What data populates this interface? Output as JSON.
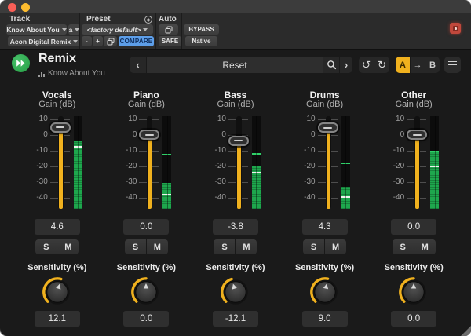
{
  "window": {
    "traffic_lights": [
      {
        "name": "close",
        "color": "#f95f57"
      },
      {
        "name": "minimize",
        "color": "#fdbc2f"
      }
    ]
  },
  "toolbar": {
    "track_label": "Track",
    "track_name": "Know About You",
    "automation_mode": "a",
    "plugin_name": "Acon Digital Remix",
    "preset_label": "Preset",
    "preset_value": "<factory default>",
    "minus_label": "-",
    "plus_label": "+",
    "compare_label": "COMPARE",
    "auto_label": "Auto",
    "safe_label": "SAFE",
    "bypass_label": "BYPASS",
    "native_label": "Native"
  },
  "header": {
    "title": "Remix",
    "subtitle": "Know About You",
    "prev_label": "‹",
    "nav_value": "Reset",
    "next_label": "›",
    "undo_label": "↺",
    "redo_label": "↻",
    "ab": {
      "a": "A",
      "arrow": "→",
      "b": "B",
      "active": "A"
    }
  },
  "strip_labels": {
    "gain": "Gain (dB)",
    "sensitivity": "Sensitivity (%)",
    "solo": "S",
    "mute": "M"
  },
  "gain_scale_ticks": [
    10,
    0,
    -10,
    -20,
    -30,
    -40
  ],
  "strips": [
    {
      "name": "Vocals",
      "gain_db": 4.6,
      "gain_display": "4.6",
      "sensitivity_pct": 12.1,
      "sensitivity_display": "12.1",
      "meter": {
        "level_db": -3.5,
        "peak_db": -7,
        "hold_db": null
      }
    },
    {
      "name": "Piano",
      "gain_db": 0.0,
      "gain_display": "0.0",
      "sensitivity_pct": 0.0,
      "sensitivity_display": "0.0",
      "meter": {
        "level_db": -30.5,
        "peak_db": -37.5,
        "hold_db": -12
      }
    },
    {
      "name": "Bass",
      "gain_db": -3.8,
      "gain_display": "-3.8",
      "sensitivity_pct": -12.1,
      "sensitivity_display": "-12.1",
      "meter": {
        "level_db": -19.5,
        "peak_db": -23.5,
        "hold_db": -11.5
      }
    },
    {
      "name": "Drums",
      "gain_db": 4.3,
      "gain_display": "4.3",
      "sensitivity_pct": 9.0,
      "sensitivity_display": "9.0",
      "meter": {
        "level_db": -33,
        "peak_db": -39,
        "hold_db": -17.5
      }
    },
    {
      "name": "Other",
      "gain_db": 0.0,
      "gain_display": "0.0",
      "sensitivity_pct": 0.0,
      "sensitivity_display": "0.0",
      "meter": {
        "level_db": -11,
        "peak_db": -19.5,
        "hold_db": -10
      }
    }
  ],
  "colors": {
    "accent_yellow": "#f0b11e",
    "meter_green": "#1ea74d",
    "compare_blue": "#5d9ee8",
    "logo_green": "#2fa84f",
    "red_button": "#c1483c"
  }
}
